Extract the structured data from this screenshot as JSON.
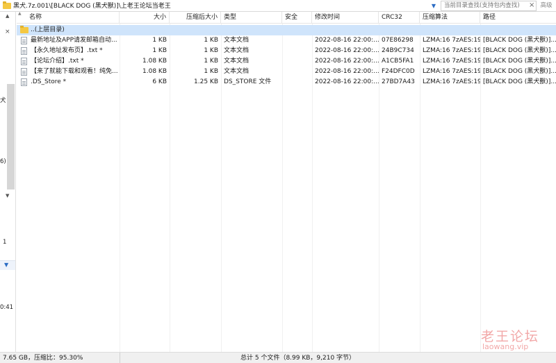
{
  "address_bar": {
    "path": "黑犬.7z.001\\[BLACK DOG (黑犬獸)]\\上老王论坛当老王",
    "search_placeholder": "当前目录查找(支持包内查找)",
    "search_button": "高级",
    "icons": {
      "folder": "folder-icon",
      "dropdown": "chevron-down-icon",
      "clear": "close-icon"
    }
  },
  "left_pane": {
    "fragments": [
      "犬",
      "6)",
      "1",
      "0:41"
    ]
  },
  "columns": [
    "名称",
    "大小",
    "压缩后大小",
    "类型",
    "安全",
    "修改时间",
    "CRC32",
    "压缩算法",
    "路径"
  ],
  "parent_row": {
    "name": "..(上层目录)"
  },
  "files": [
    {
      "name": "最新地址及APP请发邮箱自动...",
      "size": "1 KB",
      "packed": "1 KB",
      "type": "文本文档",
      "security": "",
      "modified": "2022-08-16 22:00:...",
      "crc": "07E86298",
      "method": "LZMA:16 7zAES:19",
      "path": "[BLACK DOG (黑犬獸)]..."
    },
    {
      "name": "【永久地址发布页】.txt *",
      "size": "1 KB",
      "packed": "1 KB",
      "type": "文本文档",
      "security": "",
      "modified": "2022-08-16 22:00:...",
      "crc": "24B9C734",
      "method": "LZMA:16 7zAES:19",
      "path": "[BLACK DOG (黑犬獸)]..."
    },
    {
      "name": "【论坛介绍】.txt *",
      "size": "1.08 KB",
      "packed": "1 KB",
      "type": "文本文档",
      "security": "",
      "modified": "2022-08-16 22:00:...",
      "crc": "A1CB5FA1",
      "method": "LZMA:16 7zAES:19",
      "path": "[BLACK DOG (黑犬獸)]..."
    },
    {
      "name": "【来了就能下载和观看！纯免...",
      "size": "1.08 KB",
      "packed": "1 KB",
      "type": "文本文档",
      "security": "",
      "modified": "2022-08-16 22:00:...",
      "crc": "F24DFC0D",
      "method": "LZMA:16 7zAES:19",
      "path": "[BLACK DOG (黑犬獸)]..."
    },
    {
      "name": ".DS_Store *",
      "size": "6 KB",
      "packed": "1.25 KB",
      "type": "DS_STORE 文件",
      "security": "",
      "modified": "2022-08-16 22:00:...",
      "crc": "27BD7A43",
      "method": "LZMA:16 7zAES:19",
      "path": "[BLACK DOG (黑犬獸)]..."
    }
  ],
  "status": {
    "left": "7.65 GB，压缩比：95.30%",
    "summary": "总计 5 个文件（8.99 KB，9,210 字节）"
  },
  "watermark": {
    "title": "老王论坛",
    "url": "laowang.vip"
  }
}
